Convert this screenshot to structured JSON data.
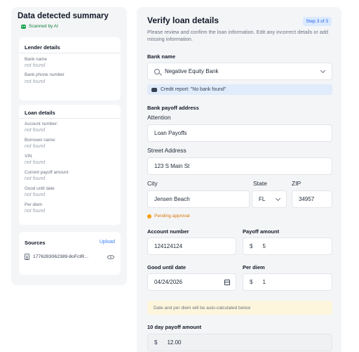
{
  "summary": {
    "title": "Data detected summary",
    "scanned_label": "Scanned by AI",
    "lender_details": {
      "title": "Lender details",
      "fields": [
        {
          "label": "Bank name",
          "value": "not found"
        },
        {
          "label": "Bank phone number",
          "value": "not found"
        }
      ]
    },
    "loan_details": {
      "title": "Loan details",
      "fields": [
        {
          "label": "Account number:",
          "value": "not found"
        },
        {
          "label": "Borrower name:",
          "value": "not found"
        },
        {
          "label": "VIN",
          "value": "not found"
        },
        {
          "label": "Current payoff amount",
          "value": "not found"
        },
        {
          "label": "Good until date",
          "value": "not found"
        },
        {
          "label": "Per diem",
          "value": "not found"
        }
      ]
    },
    "sources": {
      "title": "Sources",
      "upload_label": "Upload",
      "file_name": "1776283062389-8oFctR..."
    }
  },
  "form": {
    "title": "Verify loan details",
    "step_badge": "Step 3 of 3",
    "description": "Please review and confirm the loan information. Edit any incorrect details or add missing information.",
    "bank_name": {
      "label": "Bank name",
      "value": "Negative Equity Bank",
      "credit_note": "Credit report: \"No bank found\""
    },
    "payoff_address": {
      "label": "Bank payoff address",
      "attention_label": "Attention",
      "attention_value": "Loan Payoffs",
      "street_label": "Street Address",
      "street_value": "123 S Main St",
      "city_label": "City",
      "city_value": "Jensen Beach",
      "state_label": "State",
      "state_value": "FL",
      "zip_label": "ZIP",
      "zip_value": "34957"
    },
    "pending_label": "Pending approval",
    "account_number": {
      "label": "Account number",
      "value": "124124124"
    },
    "payoff_amount": {
      "label": "Payoff amount",
      "prefix": "$",
      "value": "5"
    },
    "good_until_date": {
      "label": "Good until date",
      "value": "04/24/2026"
    },
    "per_diem": {
      "label": "Per diem",
      "prefix": "$",
      "value": "1"
    },
    "auto_calc_note": "Date and per diem will be auto-calculated below",
    "ten_day_payoff": {
      "label": "10 day payoff amount",
      "prefix": "$",
      "value": "12.00"
    }
  },
  "colors": {
    "accent": "#3b82f6",
    "scanned": "#15803d",
    "pending": "#f59e0b",
    "panel_bg": "#f4f5f7"
  }
}
